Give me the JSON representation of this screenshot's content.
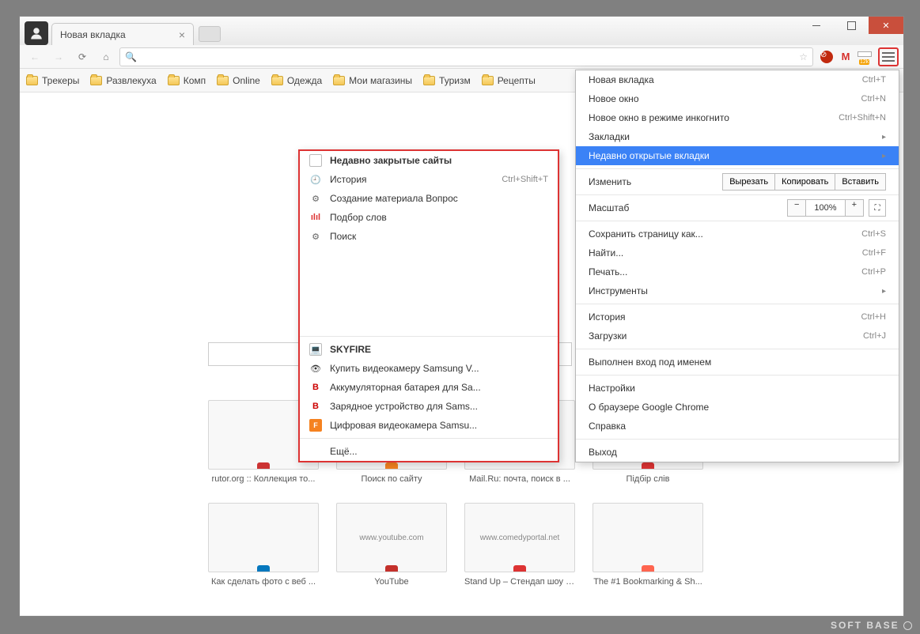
{
  "tab_title": "Новая вкладка",
  "bookmarks": [
    "Трекеры",
    "Развлекуха",
    "Комп",
    "Online",
    "Одежда",
    "Мои магазины",
    "Туризм",
    "Рецепты"
  ],
  "extensions": {
    "savefrom_badge": "12k"
  },
  "main_menu": {
    "new_tab": {
      "label": "Новая вкладка",
      "shortcut": "Ctrl+T"
    },
    "new_window": {
      "label": "Новое окно",
      "shortcut": "Ctrl+N"
    },
    "incognito": {
      "label": "Новое окно в режиме инкогнито",
      "shortcut": "Ctrl+Shift+N"
    },
    "bookmarks": {
      "label": "Закладки"
    },
    "recent_tabs": {
      "label": "Недавно открытые вкладки"
    },
    "edit": {
      "label": "Изменить",
      "cut": "Вырезать",
      "copy": "Копировать",
      "paste": "Вставить"
    },
    "zoom": {
      "label": "Масштаб",
      "value": "100%"
    },
    "save_as": {
      "label": "Сохранить страницу как...",
      "shortcut": "Ctrl+S"
    },
    "find": {
      "label": "Найти...",
      "shortcut": "Ctrl+F"
    },
    "print": {
      "label": "Печать...",
      "shortcut": "Ctrl+P"
    },
    "tools": {
      "label": "Инструменты"
    },
    "history": {
      "label": "История",
      "shortcut": "Ctrl+H"
    },
    "downloads": {
      "label": "Загрузки",
      "shortcut": "Ctrl+J"
    },
    "signed_in": {
      "label": "Выполнен вход под именем"
    },
    "settings": {
      "label": "Настройки"
    },
    "about": {
      "label": "О браузере Google Chrome"
    },
    "help": {
      "label": "Справка"
    },
    "exit": {
      "label": "Выход"
    }
  },
  "sub_menu": {
    "section1_title": "Недавно закрытые сайты",
    "history": {
      "label": "История",
      "shortcut": "Ctrl+Shift+T"
    },
    "items1": [
      "Создание материала Вопрос",
      "Подбор слов",
      "Поиск"
    ],
    "section2_title": "SKYFIRE",
    "items2": [
      "Купить видеокамеру Samsung V...",
      "Аккумуляторная батарея для Sa...",
      "Зарядное устройство для Sams...",
      "Цифровая видеокамера Samsu..."
    ],
    "more": "Ещё..."
  },
  "tiles": [
    {
      "label": "rutor.org :: Коллекция то...",
      "domain": ""
    },
    {
      "label": "Поиск по сайту",
      "domain": ""
    },
    {
      "label": "Mail.Ru: почта, поиск в ...",
      "domain": ""
    },
    {
      "label": "Підбір слів",
      "domain": ""
    },
    {
      "label": "Как сделать фото с веб ...",
      "domain": ""
    },
    {
      "label": "YouTube",
      "domain": "www.youtube.com"
    },
    {
      "label": "Stand Up – Стендап шоу /...",
      "domain": "www.comedyportal.net"
    },
    {
      "label": "The #1 Bookmarking & Sh...",
      "domain": ""
    }
  ],
  "watermark": "SOFT   BASE"
}
